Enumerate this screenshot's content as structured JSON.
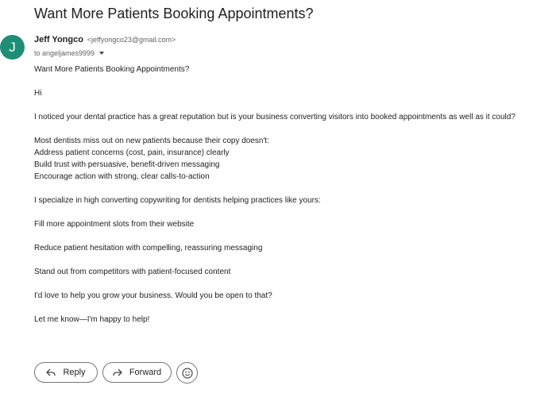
{
  "email": {
    "subject": "Want More Patients Booking Appointments?",
    "avatar_initial": "J",
    "avatar_color": "#1e8e77",
    "sender_name": "Jeff Yongco",
    "sender_email": "<jeffyongco23@gmail.com>",
    "recipient": "to angeljames9999",
    "body_lines": [
      "Want More Patients Booking Appointments?",
      "Hi",
      "I noticed your dental practice has a great reputation but is your business converting visitors into booked appointments as well as it could?",
      "Most dentists miss out on new patients because their copy doesn't:",
      " Address patient concerns (cost, pain, insurance) clearly",
      " Build trust with persuasive, benefit-driven messaging",
      " Encourage action with strong, clear calls-to-action",
      "I specialize in high converting copywriting for dentists helping practices like yours:",
      "Fill more appointment slots from their website",
      "Reduce patient hesitation with compelling, reassuring messaging",
      "Stand out from competitors with patient-focused content",
      "I'd love to help you grow your business. Would you be open to that?",
      "Let me know—I'm happy to help!"
    ]
  },
  "actions": {
    "reply_label": "Reply",
    "forward_label": "Forward",
    "reply_icon": "reply-arrow-icon",
    "forward_icon": "forward-arrow-icon",
    "emoji_icon": "smiley-face-icon"
  }
}
